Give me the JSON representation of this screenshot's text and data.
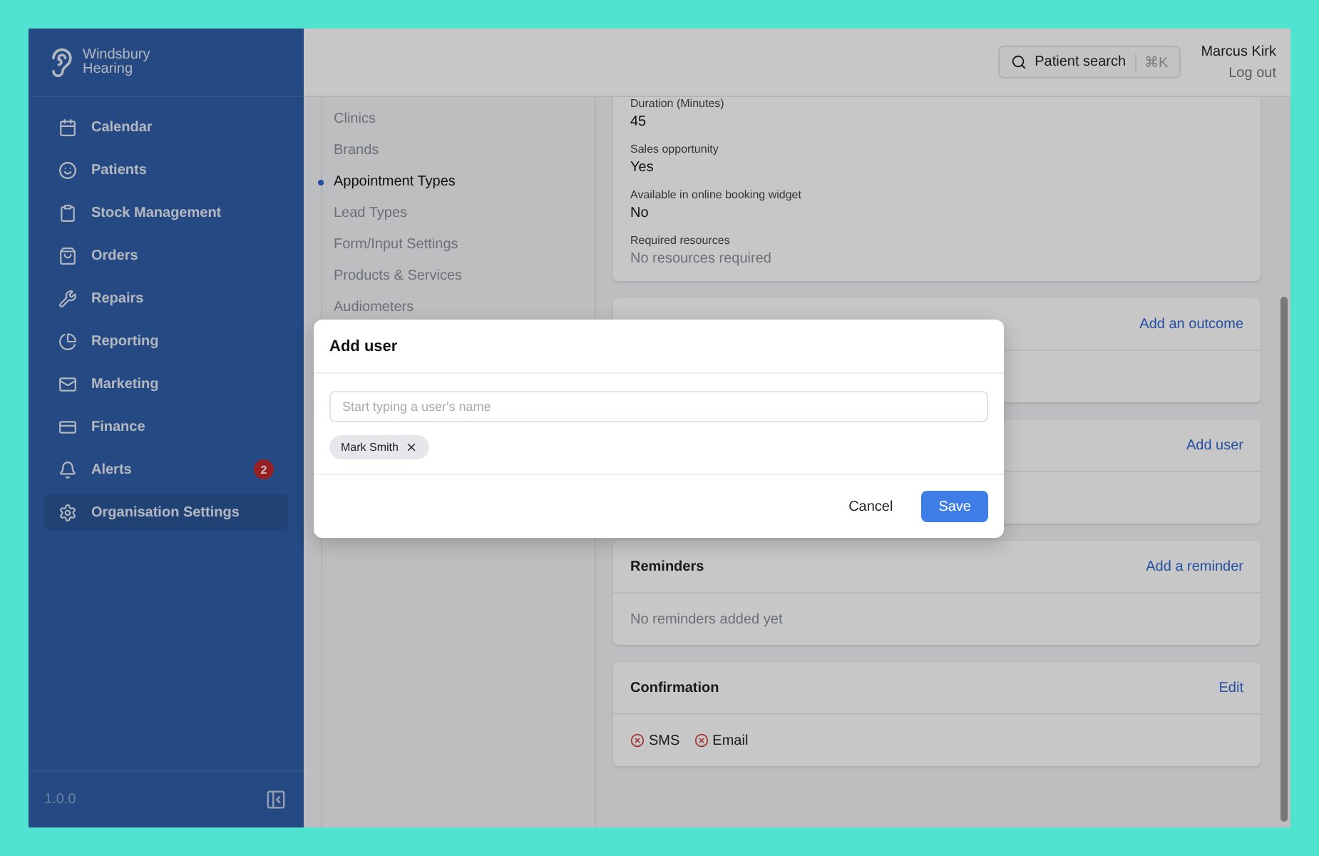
{
  "brand": {
    "line1": "Windsbury",
    "line2": "Hearing"
  },
  "sidebar": {
    "items": [
      {
        "label": "Calendar",
        "selected": false
      },
      {
        "label": "Patients",
        "selected": false
      },
      {
        "label": "Stock Management",
        "selected": false
      },
      {
        "label": "Orders",
        "selected": false
      },
      {
        "label": "Repairs",
        "selected": false
      },
      {
        "label": "Reporting",
        "selected": false
      },
      {
        "label": "Marketing",
        "selected": false
      },
      {
        "label": "Finance",
        "selected": false
      },
      {
        "label": "Alerts",
        "selected": false,
        "badge": "2"
      },
      {
        "label": "Organisation Settings",
        "selected": true
      }
    ],
    "version": "1.0.0"
  },
  "header": {
    "search_label": "Patient search",
    "shortcut": "⌘K",
    "user": "Marcus Kirk",
    "logout": "Log out"
  },
  "settings_nav": [
    {
      "label": "Clinics",
      "selected": false
    },
    {
      "label": "Brands",
      "selected": false
    },
    {
      "label": "Appointment Types",
      "selected": true
    },
    {
      "label": "Lead Types",
      "selected": false
    },
    {
      "label": "Form/Input Settings",
      "selected": false
    },
    {
      "label": "Products & Services",
      "selected": false
    },
    {
      "label": "Audiometers",
      "selected": false
    }
  ],
  "details": [
    {
      "label": "Duration (Minutes)",
      "value": "45",
      "muted": false
    },
    {
      "label": "Sales opportunity",
      "value": "Yes",
      "muted": false
    },
    {
      "label": "Available in online booking widget",
      "value": "No",
      "muted": false
    },
    {
      "label": "Required resources",
      "value": "No resources required",
      "muted": true
    }
  ],
  "cards": [
    {
      "kind": "link_only",
      "action": "Add an outcome"
    },
    {
      "kind": "link_only",
      "action": "Add user"
    },
    {
      "kind": "text",
      "title": "Reminders",
      "action": "Add a reminder",
      "body": "No reminders added yet"
    },
    {
      "kind": "channels",
      "title": "Confirmation",
      "action": "Edit",
      "channels": [
        {
          "label": "SMS",
          "enabled": false
        },
        {
          "label": "Email",
          "enabled": false
        }
      ]
    }
  ],
  "modal": {
    "title": "Add user",
    "placeholder": "Start typing a user's name",
    "chips": [
      "Mark Smith"
    ],
    "cancel": "Cancel",
    "save": "Save"
  }
}
